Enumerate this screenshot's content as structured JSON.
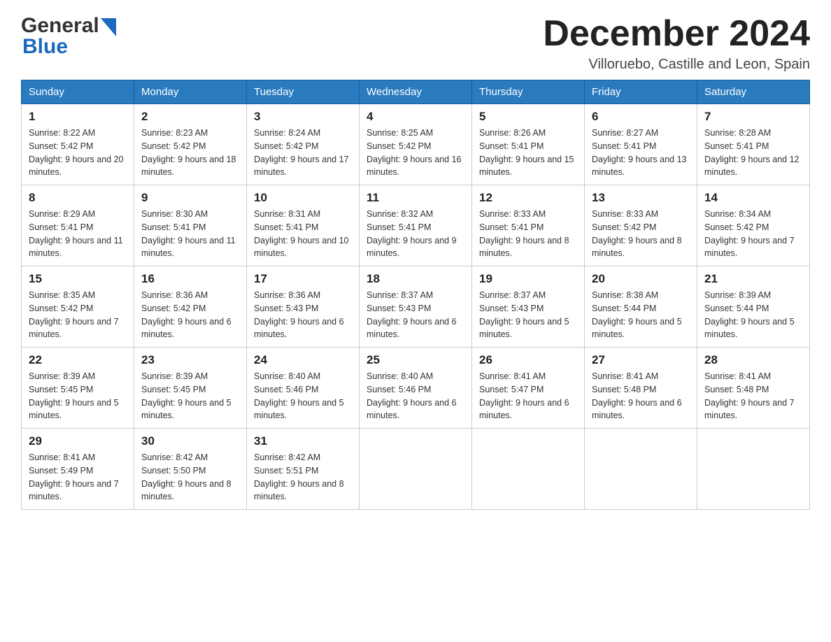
{
  "header": {
    "logo_general": "General",
    "logo_blue": "Blue",
    "month_title": "December 2024",
    "subtitle": "Villoruebo, Castille and Leon, Spain"
  },
  "days_of_week": [
    "Sunday",
    "Monday",
    "Tuesday",
    "Wednesday",
    "Thursday",
    "Friday",
    "Saturday"
  ],
  "weeks": [
    [
      {
        "day": "1",
        "sunrise": "Sunrise: 8:22 AM",
        "sunset": "Sunset: 5:42 PM",
        "daylight": "Daylight: 9 hours and 20 minutes."
      },
      {
        "day": "2",
        "sunrise": "Sunrise: 8:23 AM",
        "sunset": "Sunset: 5:42 PM",
        "daylight": "Daylight: 9 hours and 18 minutes."
      },
      {
        "day": "3",
        "sunrise": "Sunrise: 8:24 AM",
        "sunset": "Sunset: 5:42 PM",
        "daylight": "Daylight: 9 hours and 17 minutes."
      },
      {
        "day": "4",
        "sunrise": "Sunrise: 8:25 AM",
        "sunset": "Sunset: 5:42 PM",
        "daylight": "Daylight: 9 hours and 16 minutes."
      },
      {
        "day": "5",
        "sunrise": "Sunrise: 8:26 AM",
        "sunset": "Sunset: 5:41 PM",
        "daylight": "Daylight: 9 hours and 15 minutes."
      },
      {
        "day": "6",
        "sunrise": "Sunrise: 8:27 AM",
        "sunset": "Sunset: 5:41 PM",
        "daylight": "Daylight: 9 hours and 13 minutes."
      },
      {
        "day": "7",
        "sunrise": "Sunrise: 8:28 AM",
        "sunset": "Sunset: 5:41 PM",
        "daylight": "Daylight: 9 hours and 12 minutes."
      }
    ],
    [
      {
        "day": "8",
        "sunrise": "Sunrise: 8:29 AM",
        "sunset": "Sunset: 5:41 PM",
        "daylight": "Daylight: 9 hours and 11 minutes."
      },
      {
        "day": "9",
        "sunrise": "Sunrise: 8:30 AM",
        "sunset": "Sunset: 5:41 PM",
        "daylight": "Daylight: 9 hours and 11 minutes."
      },
      {
        "day": "10",
        "sunrise": "Sunrise: 8:31 AM",
        "sunset": "Sunset: 5:41 PM",
        "daylight": "Daylight: 9 hours and 10 minutes."
      },
      {
        "day": "11",
        "sunrise": "Sunrise: 8:32 AM",
        "sunset": "Sunset: 5:41 PM",
        "daylight": "Daylight: 9 hours and 9 minutes."
      },
      {
        "day": "12",
        "sunrise": "Sunrise: 8:33 AM",
        "sunset": "Sunset: 5:41 PM",
        "daylight": "Daylight: 9 hours and 8 minutes."
      },
      {
        "day": "13",
        "sunrise": "Sunrise: 8:33 AM",
        "sunset": "Sunset: 5:42 PM",
        "daylight": "Daylight: 9 hours and 8 minutes."
      },
      {
        "day": "14",
        "sunrise": "Sunrise: 8:34 AM",
        "sunset": "Sunset: 5:42 PM",
        "daylight": "Daylight: 9 hours and 7 minutes."
      }
    ],
    [
      {
        "day": "15",
        "sunrise": "Sunrise: 8:35 AM",
        "sunset": "Sunset: 5:42 PM",
        "daylight": "Daylight: 9 hours and 7 minutes."
      },
      {
        "day": "16",
        "sunrise": "Sunrise: 8:36 AM",
        "sunset": "Sunset: 5:42 PM",
        "daylight": "Daylight: 9 hours and 6 minutes."
      },
      {
        "day": "17",
        "sunrise": "Sunrise: 8:36 AM",
        "sunset": "Sunset: 5:43 PM",
        "daylight": "Daylight: 9 hours and 6 minutes."
      },
      {
        "day": "18",
        "sunrise": "Sunrise: 8:37 AM",
        "sunset": "Sunset: 5:43 PM",
        "daylight": "Daylight: 9 hours and 6 minutes."
      },
      {
        "day": "19",
        "sunrise": "Sunrise: 8:37 AM",
        "sunset": "Sunset: 5:43 PM",
        "daylight": "Daylight: 9 hours and 5 minutes."
      },
      {
        "day": "20",
        "sunrise": "Sunrise: 8:38 AM",
        "sunset": "Sunset: 5:44 PM",
        "daylight": "Daylight: 9 hours and 5 minutes."
      },
      {
        "day": "21",
        "sunrise": "Sunrise: 8:39 AM",
        "sunset": "Sunset: 5:44 PM",
        "daylight": "Daylight: 9 hours and 5 minutes."
      }
    ],
    [
      {
        "day": "22",
        "sunrise": "Sunrise: 8:39 AM",
        "sunset": "Sunset: 5:45 PM",
        "daylight": "Daylight: 9 hours and 5 minutes."
      },
      {
        "day": "23",
        "sunrise": "Sunrise: 8:39 AM",
        "sunset": "Sunset: 5:45 PM",
        "daylight": "Daylight: 9 hours and 5 minutes."
      },
      {
        "day": "24",
        "sunrise": "Sunrise: 8:40 AM",
        "sunset": "Sunset: 5:46 PM",
        "daylight": "Daylight: 9 hours and 5 minutes."
      },
      {
        "day": "25",
        "sunrise": "Sunrise: 8:40 AM",
        "sunset": "Sunset: 5:46 PM",
        "daylight": "Daylight: 9 hours and 6 minutes."
      },
      {
        "day": "26",
        "sunrise": "Sunrise: 8:41 AM",
        "sunset": "Sunset: 5:47 PM",
        "daylight": "Daylight: 9 hours and 6 minutes."
      },
      {
        "day": "27",
        "sunrise": "Sunrise: 8:41 AM",
        "sunset": "Sunset: 5:48 PM",
        "daylight": "Daylight: 9 hours and 6 minutes."
      },
      {
        "day": "28",
        "sunrise": "Sunrise: 8:41 AM",
        "sunset": "Sunset: 5:48 PM",
        "daylight": "Daylight: 9 hours and 7 minutes."
      }
    ],
    [
      {
        "day": "29",
        "sunrise": "Sunrise: 8:41 AM",
        "sunset": "Sunset: 5:49 PM",
        "daylight": "Daylight: 9 hours and 7 minutes."
      },
      {
        "day": "30",
        "sunrise": "Sunrise: 8:42 AM",
        "sunset": "Sunset: 5:50 PM",
        "daylight": "Daylight: 9 hours and 8 minutes."
      },
      {
        "day": "31",
        "sunrise": "Sunrise: 8:42 AM",
        "sunset": "Sunset: 5:51 PM",
        "daylight": "Daylight: 9 hours and 8 minutes."
      },
      null,
      null,
      null,
      null
    ]
  ]
}
